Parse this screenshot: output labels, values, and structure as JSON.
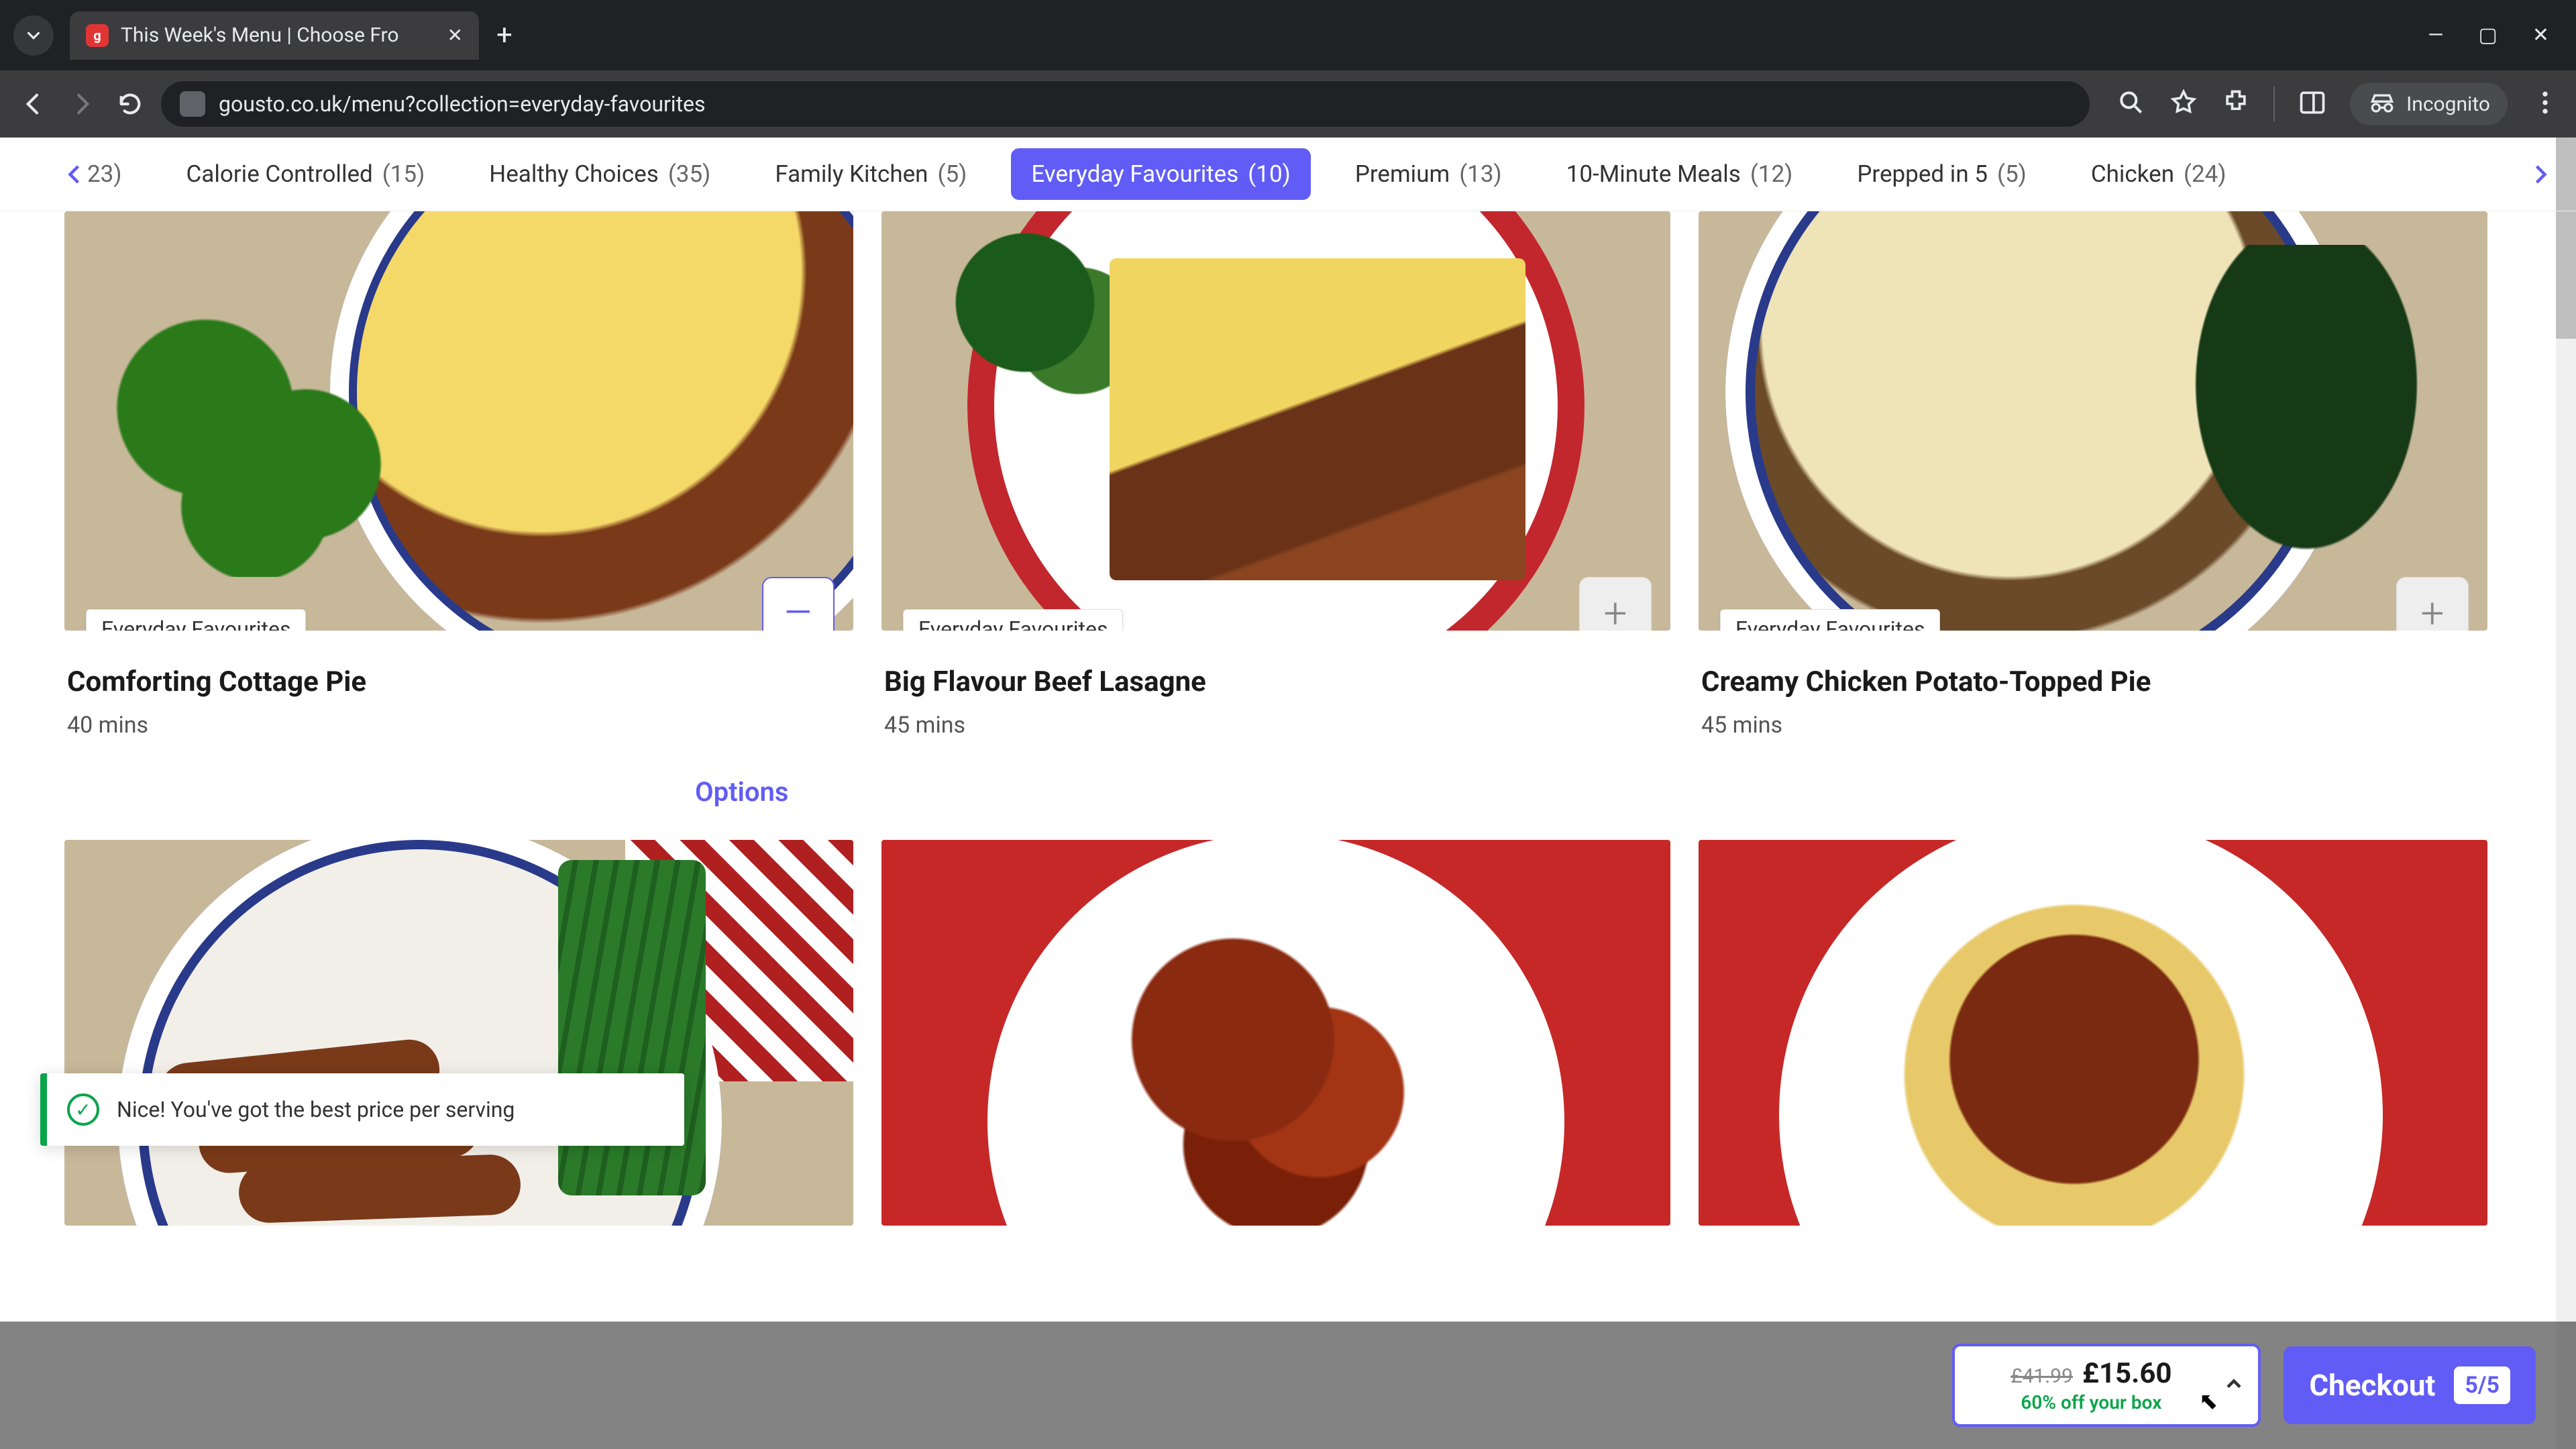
{
  "browser": {
    "tab_title": "This Week's Menu | Choose Fro",
    "favicon_letter": "g",
    "url": "gousto.co.uk/menu?collection=everyday-favourites",
    "incognito_label": "Incognito"
  },
  "categories": {
    "cutoff_count": "23)",
    "items": [
      {
        "label": "Calorie Controlled",
        "count": "(15)"
      },
      {
        "label": "Healthy Choices",
        "count": "(35)"
      },
      {
        "label": "Family Kitchen",
        "count": "(5)"
      },
      {
        "label": "Everyday Favourites",
        "count": "(10)",
        "active": true
      },
      {
        "label": "Premium",
        "count": "(13)"
      },
      {
        "label": "10-Minute Meals",
        "count": "(12)"
      },
      {
        "label": "Prepped in 5",
        "count": "(5)"
      },
      {
        "label": "Chicken",
        "count": "(24)"
      }
    ]
  },
  "recipes_row1": [
    {
      "tag": "Everyday Favourites",
      "title": "Comforting Cottage Pie",
      "time": "40 mins",
      "btn": "–",
      "btn_style": "minus"
    },
    {
      "tag": "Everyday Favourites",
      "title": "Big Flavour Beef Lasagne",
      "time": "45 mins",
      "btn": "+",
      "btn_style": "plus"
    },
    {
      "tag": "Everyday Favourites",
      "title": "Creamy Chicken Potato-Topped Pie",
      "time": "45 mins",
      "btn": "+",
      "btn_style": "plus"
    }
  ],
  "options_label": "Options",
  "toast": {
    "message": "Nice! You've got the best price per serving"
  },
  "footer": {
    "old_price": "£41.99",
    "new_price": "£15.60",
    "deal": "60% off your box",
    "checkout_label": "Checkout",
    "count_badge": "5/5"
  },
  "icons": {
    "close_x": "✕",
    "plus": "+",
    "minimize": "—",
    "maximize": "▢",
    "check": "✓",
    "cursor": "↖"
  },
  "colors": {
    "accent": "#615cf5",
    "success": "#0aa54a"
  }
}
